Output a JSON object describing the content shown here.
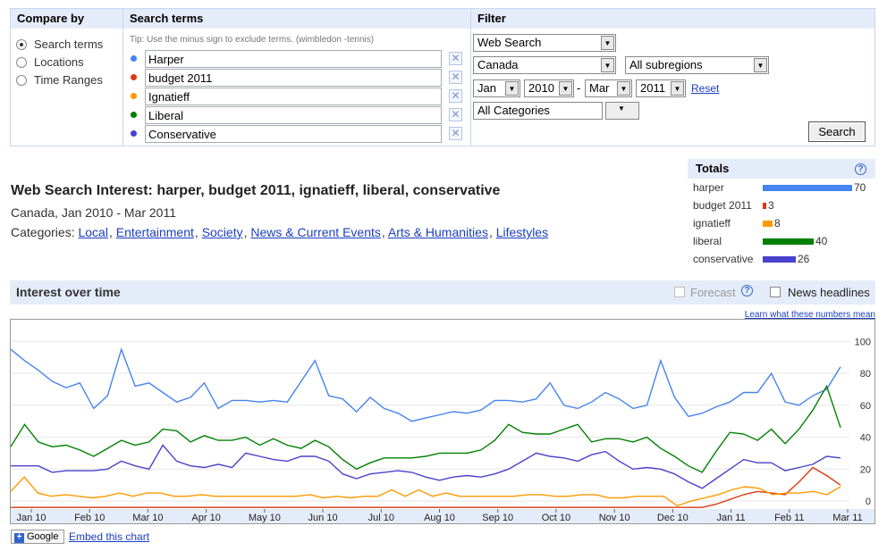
{
  "compare": {
    "header": "Compare by",
    "options": [
      {
        "label": "Search terms",
        "selected": true
      },
      {
        "label": "Locations",
        "selected": false
      },
      {
        "label": "Time Ranges",
        "selected": false
      }
    ]
  },
  "search_terms": {
    "header": "Search terms",
    "tip": "Tip: Use the minus sign to exclude terms. (wimbledon -tennis)",
    "terms": [
      {
        "value": "Harper",
        "color": "#4684ee"
      },
      {
        "value": "budget 2011",
        "color": "#dc3912"
      },
      {
        "value": "Ignatieff",
        "color": "#ff9900"
      },
      {
        "value": "Liberal",
        "color": "#008000"
      },
      {
        "value": "Conservative",
        "color": "#4942cc"
      }
    ],
    "remove_icon": "close-icon"
  },
  "filter": {
    "header": "Filter",
    "property": "Web Search",
    "country": "Canada",
    "subregion": "All subregions",
    "from_month": "Jan",
    "from_year": "2010",
    "to_month": "Mar",
    "to_year": "2011",
    "dash": "-",
    "reset_label": "Reset",
    "category": "All Categories",
    "search_label": "Search"
  },
  "results": {
    "title": "Web Search Interest: harper, budget 2011, ignatieff, liberal, conservative",
    "subtitle": "Canada, Jan 2010 - Mar 2011",
    "categories_label": "Categories:",
    "categories": [
      "Local",
      "Entertainment",
      "Society",
      "News & Current Events",
      "Arts & Humanities",
      "Lifestyles"
    ]
  },
  "totals": {
    "header": "Totals",
    "help_icon": "help-icon",
    "items": [
      {
        "name": "harper",
        "value": 70,
        "color": "#4684ee"
      },
      {
        "name": "budget 2011",
        "value": 3,
        "color": "#dc3912"
      },
      {
        "name": "ignatieff",
        "value": 8,
        "color": "#ff9900"
      },
      {
        "name": "liberal",
        "value": 40,
        "color": "#008000"
      },
      {
        "name": "conservative",
        "value": 26,
        "color": "#4942cc"
      }
    ]
  },
  "interest_bar": {
    "title": "Interest over time",
    "forecast_label": "Forecast",
    "forecast_checked": false,
    "forecast_enabled": false,
    "headlines_label": "News headlines",
    "headlines_checked": false,
    "learn_link": "Learn what these numbers mean"
  },
  "chart_data": {
    "type": "line",
    "x_ticks": [
      "Jan 10",
      "Feb 10",
      "Mar 10",
      "Apr 10",
      "May 10",
      "Jun 10",
      "Jul 10",
      "Aug 10",
      "Sep 10",
      "Oct 10",
      "Nov 10",
      "Dec 10",
      "Jan 11",
      "Feb 11",
      "Mar 11"
    ],
    "y_ticks": [
      0,
      20,
      40,
      60,
      80,
      100
    ],
    "ylim": [
      -5,
      108
    ],
    "grid": "horizontal",
    "series": [
      {
        "name": "Harper",
        "color": "#4684ee",
        "values": [
          95,
          88,
          82,
          75,
          71,
          74,
          58,
          66,
          95,
          72,
          74,
          68,
          62,
          65,
          74,
          58,
          63,
          63,
          62,
          63,
          62,
          75,
          88,
          66,
          64,
          56,
          65,
          58,
          55,
          50,
          52,
          54,
          56,
          55,
          57,
          63,
          63,
          62,
          64,
          74,
          60,
          58,
          62,
          68,
          64,
          58,
          60,
          88,
          65,
          53,
          55,
          59,
          62,
          68,
          68,
          80,
          62,
          60,
          66,
          70,
          84
        ]
      },
      {
        "name": "budget 2011",
        "color": "#dc3912",
        "values": [
          -4,
          -4,
          -4,
          -4,
          -4,
          -4,
          -4,
          -4,
          -4,
          -4,
          -4,
          -4,
          -4,
          -4,
          -4,
          -4,
          -4,
          -4,
          -4,
          -4,
          -4,
          -4,
          -4,
          -4,
          -4,
          -4,
          -4,
          -4,
          -4,
          -4,
          -4,
          -4,
          -4,
          -4,
          -4,
          -4,
          -4,
          -4,
          -4,
          -4,
          -4,
          -4,
          -4,
          -4,
          -4,
          -4,
          -4,
          -4,
          -4,
          -4,
          -4,
          -2,
          1,
          4,
          6,
          5,
          4,
          12,
          21,
          16,
          10
        ]
      },
      {
        "name": "Ignatieff",
        "color": "#ff9900",
        "values": [
          6,
          15,
          5,
          3,
          4,
          3,
          2,
          3,
          5,
          3,
          5,
          5,
          3,
          3,
          4,
          3,
          3,
          3,
          3,
          3,
          3,
          3,
          4,
          2,
          3,
          2,
          3,
          3,
          7,
          3,
          7,
          3,
          5,
          3,
          3,
          3,
          3,
          3,
          4,
          4,
          3,
          3,
          4,
          4,
          2,
          2,
          3,
          3,
          3,
          -3,
          0,
          2,
          4,
          7,
          9,
          8,
          4,
          5,
          5,
          6,
          4,
          9
        ]
      },
      {
        "name": "Liberal",
        "color": "#008000",
        "values": [
          34,
          48,
          37,
          34,
          35,
          32,
          28,
          33,
          38,
          35,
          37,
          45,
          44,
          37,
          41,
          38,
          38,
          40,
          35,
          39,
          35,
          33,
          38,
          34,
          26,
          20,
          24,
          27,
          27,
          27,
          28,
          30,
          30,
          30,
          32,
          38,
          48,
          43,
          42,
          42,
          45,
          48,
          37,
          39,
          39,
          37,
          40,
          33,
          28,
          22,
          18,
          31,
          43,
          42,
          38,
          45,
          36,
          45,
          57,
          72,
          46
        ]
      },
      {
        "name": "Conservative",
        "color": "#4942cc",
        "values": [
          22,
          22,
          22,
          18,
          19,
          19,
          19,
          20,
          25,
          22,
          20,
          35,
          25,
          22,
          21,
          23,
          21,
          30,
          28,
          26,
          25,
          28,
          28,
          25,
          17,
          14,
          17,
          18,
          19,
          18,
          15,
          13,
          15,
          16,
          15,
          17,
          20,
          25,
          30,
          28,
          27,
          25,
          29,
          31,
          25,
          20,
          21,
          20,
          17,
          12,
          8,
          14,
          20,
          26,
          24,
          24,
          19,
          21,
          23,
          28,
          27
        ]
      }
    ]
  },
  "footer": {
    "logo_text": "Google",
    "embed_label": "Embed this chart"
  }
}
